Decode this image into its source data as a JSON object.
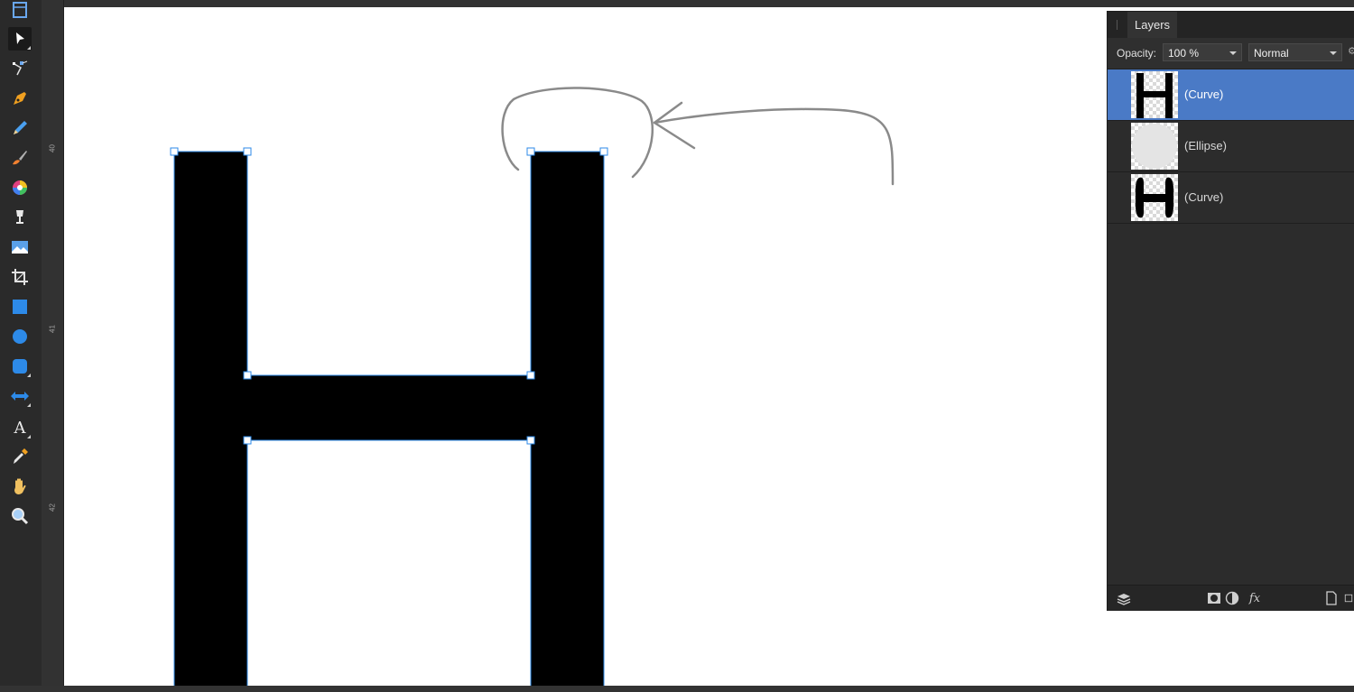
{
  "toolbar": {
    "tools": [
      {
        "name": "view-tool-icon"
      },
      {
        "name": "move-tool-icon",
        "active": true
      },
      {
        "name": "node-tool-icon"
      },
      {
        "name": "pen-tool-icon"
      },
      {
        "name": "pencil-tool-icon"
      },
      {
        "name": "vector-brush-tool-icon"
      },
      {
        "name": "fill-tool-icon"
      },
      {
        "name": "transparency-tool-icon"
      },
      {
        "name": "place-image-tool-icon"
      },
      {
        "name": "crop-tool-icon"
      },
      {
        "name": "rectangle-tool-icon"
      },
      {
        "name": "ellipse-tool-icon"
      },
      {
        "name": "rounded-rectangle-tool-icon"
      },
      {
        "name": "arrow-shape-tool-icon"
      },
      {
        "name": "artistic-text-tool-icon",
        "label": "A"
      },
      {
        "name": "color-picker-tool-icon"
      },
      {
        "name": "hand-tool-icon"
      },
      {
        "name": "zoom-tool-icon"
      }
    ]
  },
  "ruler": {
    "vertical_labels": [
      "40",
      "41",
      "42"
    ]
  },
  "layers_panel": {
    "tab_label": "Layers",
    "opacity_label": "Opacity:",
    "opacity_value": "100 %",
    "blend_mode": "Normal",
    "layers": [
      {
        "name": "(Curve)",
        "selected": true,
        "thumb": "h-outline"
      },
      {
        "name": "(Ellipse)",
        "selected": false,
        "thumb": "ellipse"
      },
      {
        "name": "(Curve)",
        "selected": false,
        "thumb": "h-rounded"
      }
    ],
    "footer_icons": [
      "layers-stack-icon",
      "mask-icon",
      "adjustment-icon",
      "fx-icon",
      "add-layer-icon",
      "add-group-icon"
    ],
    "fx_label": "fx"
  },
  "colors": {
    "selection_blue": "#4a7ac6",
    "accent_blue": "#2d8ae8",
    "canvas": "#ffffff",
    "panel_bg": "#2c2c2c"
  }
}
